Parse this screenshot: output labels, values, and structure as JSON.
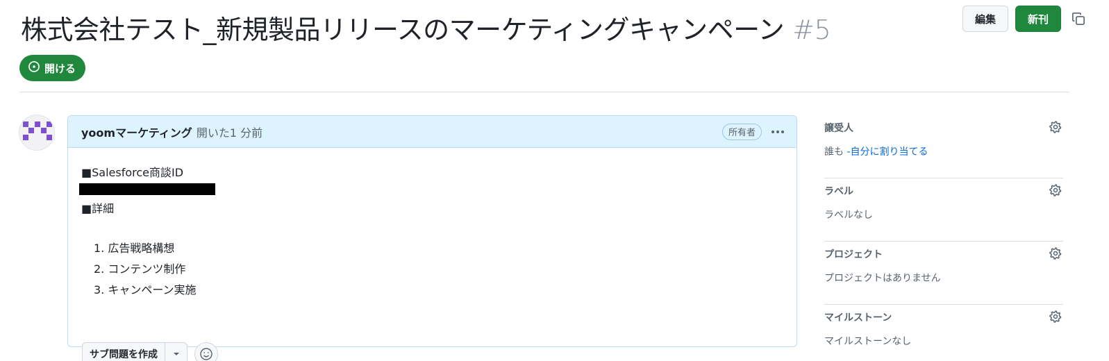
{
  "issue": {
    "title": "株式会社テスト_新規製品リリースのマーケティングキャンペーン",
    "number": "#5",
    "state_label": "開ける"
  },
  "header_actions": {
    "edit_label": "編集",
    "new_label": "新刊",
    "copy_icon": "copy-icon"
  },
  "comment": {
    "author": "yoomマーケティング",
    "opened_text": "開いた1 分前",
    "owner_badge": "所有者",
    "body": {
      "line1": "■Salesforce商談ID",
      "line3": "■詳細",
      "list": [
        "1. 広告戦略構想",
        "2. コンテンツ制作",
        "3. キャンペーン実施"
      ]
    },
    "create_subissue_label": "サブ問題を作成"
  },
  "sidebar": {
    "assignees": {
      "title": "譲受人",
      "value_prefix": "誰も",
      "value_link": " -自分に割り当てる"
    },
    "labels": {
      "title": "ラベル",
      "value": "ラベルなし"
    },
    "projects": {
      "title": "プロジェクト",
      "value": "プロジェクトはありません"
    },
    "milestone": {
      "title": "マイルストーン",
      "value": "マイルストーンなし"
    }
  },
  "colors": {
    "accent_green": "#1f883d",
    "link_blue": "#0969da",
    "comment_header_bg": "#ddf4ff",
    "avatar_purple": "#7e4fd6"
  }
}
